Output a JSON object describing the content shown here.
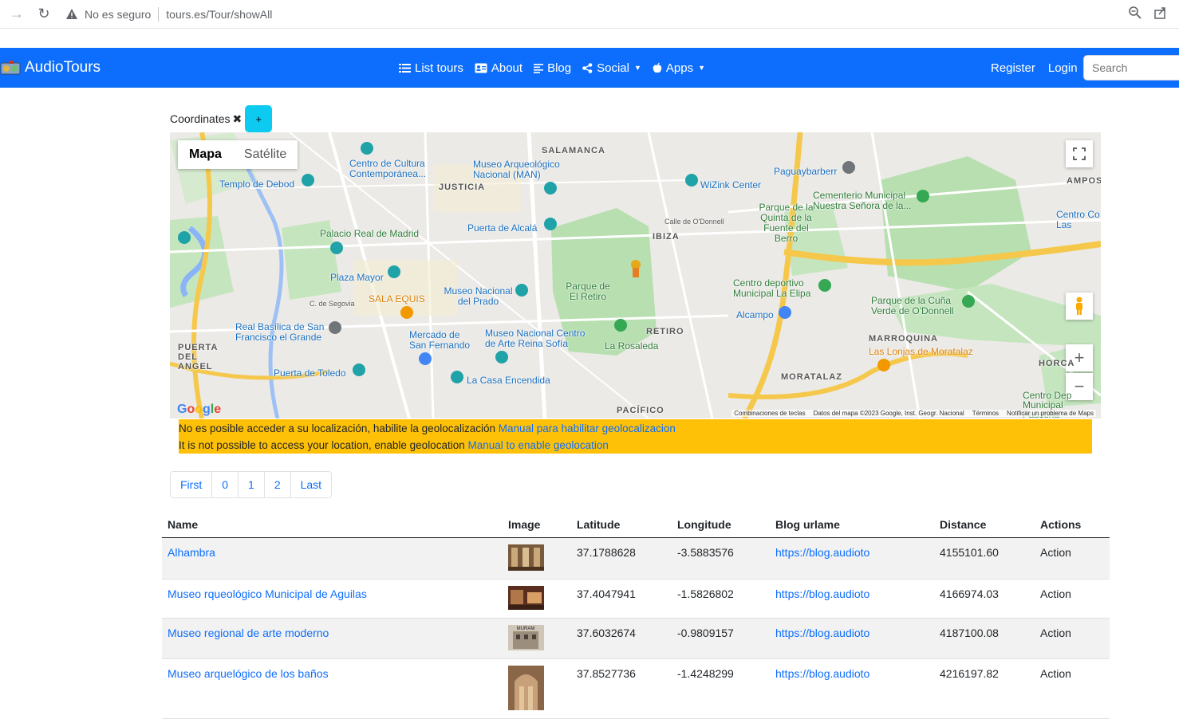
{
  "browser": {
    "security_label": "No es seguro",
    "url": "tours.es/Tour/showAll"
  },
  "navbar": {
    "brand": "AudioTours",
    "items": [
      {
        "label": "List tours",
        "icon": "list-icon"
      },
      {
        "label": "About",
        "icon": "id-card-icon"
      },
      {
        "label": "Blog",
        "icon": "text-lines-icon"
      },
      {
        "label": "Social",
        "icon": "share-icon"
      },
      {
        "label": "Apps",
        "icon": "apple-icon"
      }
    ],
    "register": "Register",
    "login": "Login",
    "search_placeholder": "Search"
  },
  "coordinates": {
    "label": "Coordinates",
    "add_label": "+"
  },
  "map": {
    "map_type_options": [
      "Mapa",
      "Satélite"
    ],
    "selected_map_type": "Mapa",
    "labels": [
      {
        "text": "SALAMANCA",
        "kind": "dark"
      },
      {
        "text": "JUSTICIA",
        "kind": "dark"
      },
      {
        "text": "IBIZA",
        "kind": "dark"
      },
      {
        "text": "RETIRO",
        "kind": "dark"
      },
      {
        "text": "PUERTA DEL ANGEL",
        "kind": "dark"
      },
      {
        "text": "MORATALAZ",
        "kind": "dark"
      },
      {
        "text": "MARROQUINA",
        "kind": "dark"
      },
      {
        "text": "PACÍFICO",
        "kind": "dark"
      },
      {
        "text": "Centro de Cultura Contemporánea...",
        "kind": "blue"
      },
      {
        "text": "Museo Arqueológico Nacional (MAN)",
        "kind": "blue"
      },
      {
        "text": "Templo de Debod",
        "kind": "blue"
      },
      {
        "text": "WiZink Center",
        "kind": "blue"
      },
      {
        "text": "Paguaybarberr",
        "kind": "blue"
      },
      {
        "text": "Palacio Real de Madrid",
        "kind": "green"
      },
      {
        "text": "Puerta de Alcalá",
        "kind": "blue"
      },
      {
        "text": "Plaza Mayor",
        "kind": "blue"
      },
      {
        "text": "Parque de El Retiro",
        "kind": "green"
      },
      {
        "text": "Museo Nacional del Prado",
        "kind": "blue"
      },
      {
        "text": "SALA EQUIS",
        "kind": "orange"
      },
      {
        "text": "Real Basílica de San Francisco el Grande",
        "kind": "blue"
      },
      {
        "text": "Mercado de San Fernando",
        "kind": "blue"
      },
      {
        "text": "Museo Nacional Centro de Arte Reina Sofía",
        "kind": "blue"
      },
      {
        "text": "La Rosaleda",
        "kind": "green"
      },
      {
        "text": "Puerta de Toledo",
        "kind": "blue"
      },
      {
        "text": "La Casa Encendida",
        "kind": "blue"
      },
      {
        "text": "Parque de la Quinta de la Fuente del Berro",
        "kind": "green"
      },
      {
        "text": "Cementerio Municipal Nuestra Señora de la...",
        "kind": "green"
      },
      {
        "text": "Centro deportivo Municipal La Elipa",
        "kind": "green"
      },
      {
        "text": "Alcampo",
        "kind": "blue"
      },
      {
        "text": "Parque de la Cuña Verde de O'Donnell",
        "kind": "green"
      },
      {
        "text": "Las Lonjas de Moratalaz",
        "kind": "orange"
      },
      {
        "text": "Centro Dep Municipal Faustina",
        "kind": "green"
      },
      {
        "text": "Centro Co Las",
        "kind": "blue"
      },
      {
        "text": "HORCA",
        "kind": "dark"
      },
      {
        "text": "AMPOS",
        "kind": "dark"
      },
      {
        "text": "Calle de O'Donnell",
        "kind": "street"
      },
      {
        "text": "C. de Segovia",
        "kind": "street"
      }
    ],
    "attribution": {
      "shortcuts": "Combinaciones de teclas",
      "data": "Datos del mapa ©2023 Google, Inst. Geogr. Nacional",
      "terms": "Términos",
      "report": "Notificar un problema de Maps"
    },
    "logo": "Google"
  },
  "alert": {
    "es_text": "No es posible acceder a su localización, habilite la geolocalización",
    "es_link": "Manual para habilitar geolocalizacion",
    "en_text": "It is not possible to access your location, enable geolocation",
    "en_link": "Manual to enable geolocation",
    "color": "#ffc107"
  },
  "pagination": [
    "First",
    "0",
    "1",
    "2",
    "Last"
  ],
  "table": {
    "headers": [
      "Name",
      "Image",
      "Latitude",
      "Longitude",
      "Blog urlame",
      "Distance",
      "Actions"
    ],
    "rows": [
      {
        "name": "Alhambra",
        "latitude": "37.1788628",
        "longitude": "-3.5883576",
        "blog": "https://blog.audioto",
        "distance": "4155101.60",
        "action": "Action"
      },
      {
        "name": "Museo rqueológico Municipal de Aguilas",
        "latitude": "37.4047941",
        "longitude": "-1.5826802",
        "blog": "https://blog.audioto",
        "distance": "4166974.03",
        "action": "Action"
      },
      {
        "name": "Museo regional de arte moderno",
        "latitude": "37.6032674",
        "longitude": "-0.9809157",
        "blog": "https://blog.audioto",
        "distance": "4187100.08",
        "action": "Action",
        "image_text": "MURAM"
      },
      {
        "name": "Museo arquelógico de los baños",
        "latitude": "37.8527736",
        "longitude": "-1.4248299",
        "blog": "https://blog.audioto",
        "distance": "4216197.82",
        "action": "Action"
      }
    ]
  },
  "colors": {
    "navbar": "#0d6efd",
    "button_info": "#0dcaf0",
    "link": "#0d6efd"
  }
}
